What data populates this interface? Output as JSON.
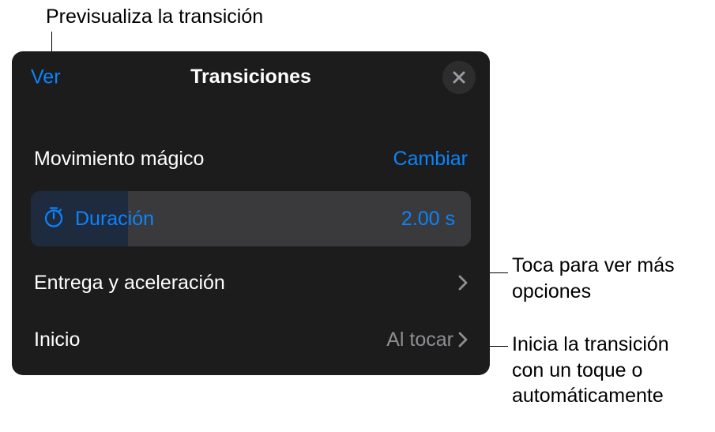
{
  "callouts": {
    "preview": "Previsualiza la transición",
    "moreOptions_line1": "Toca para ver más",
    "moreOptions_line2": "opciones",
    "start_line1": "Inicia la transición",
    "start_line2": "con un toque o",
    "start_line3": "automáticamente"
  },
  "panel": {
    "header": {
      "left": "Ver",
      "title": "Transiciones"
    },
    "section": {
      "name": "Movimiento mágico",
      "change": "Cambiar"
    },
    "duration": {
      "label": "Duración",
      "value": "2.00 s"
    },
    "rows": {
      "delivery": {
        "label": "Entrega y aceleración"
      },
      "start": {
        "label": "Inicio",
        "value": "Al tocar"
      }
    }
  },
  "colors": {
    "accent": "#0a84ff",
    "panelBg": "#1c1c1c",
    "rowBg": "#3a3a3c",
    "fillBg": "#1e2b3f",
    "muted": "#8e8e93"
  }
}
